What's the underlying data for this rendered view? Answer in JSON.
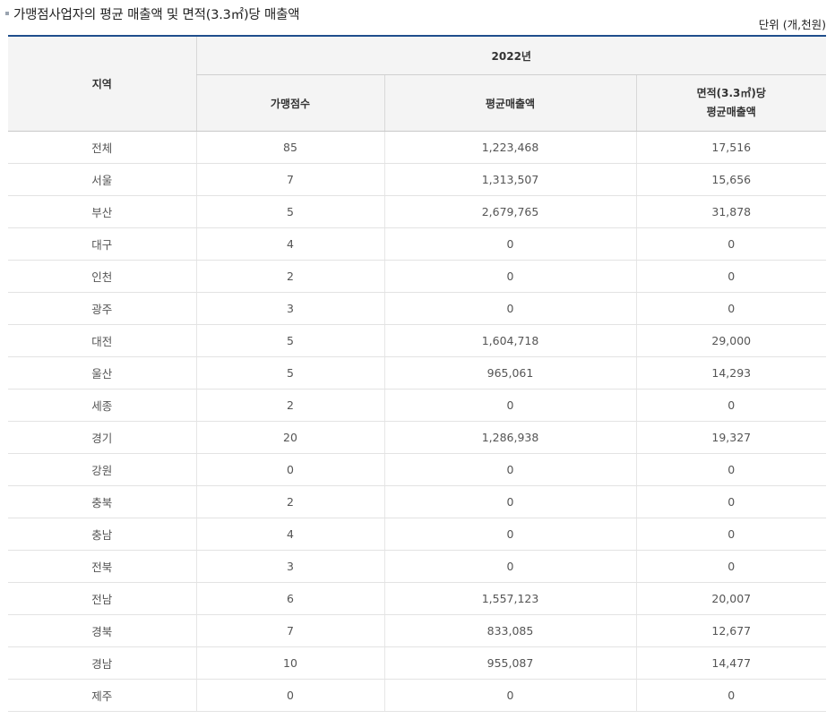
{
  "page": {
    "title": "가맹점사업자의 평균 매출액 및 면적(3.3㎡)당 매출액",
    "unit": "단위 (개,천원)"
  },
  "table": {
    "header": {
      "region": "지역",
      "year": "2022년",
      "stores": "가맹점수",
      "avg_sales": "평균매출액",
      "per_area_line1": "면적(3.3㎡)당",
      "per_area_line2": "평균매출액"
    },
    "rows": [
      {
        "region": "전체",
        "stores": "85",
        "avg_sales": "1,223,468",
        "per_area": "17,516"
      },
      {
        "region": "서울",
        "stores": "7",
        "avg_sales": "1,313,507",
        "per_area": "15,656"
      },
      {
        "region": "부산",
        "stores": "5",
        "avg_sales": "2,679,765",
        "per_area": "31,878"
      },
      {
        "region": "대구",
        "stores": "4",
        "avg_sales": "0",
        "per_area": "0"
      },
      {
        "region": "인천",
        "stores": "2",
        "avg_sales": "0",
        "per_area": "0"
      },
      {
        "region": "광주",
        "stores": "3",
        "avg_sales": "0",
        "per_area": "0"
      },
      {
        "region": "대전",
        "stores": "5",
        "avg_sales": "1,604,718",
        "per_area": "29,000"
      },
      {
        "region": "울산",
        "stores": "5",
        "avg_sales": "965,061",
        "per_area": "14,293"
      },
      {
        "region": "세종",
        "stores": "2",
        "avg_sales": "0",
        "per_area": "0"
      },
      {
        "region": "경기",
        "stores": "20",
        "avg_sales": "1,286,938",
        "per_area": "19,327"
      },
      {
        "region": "강원",
        "stores": "0",
        "avg_sales": "0",
        "per_area": "0"
      },
      {
        "region": "충북",
        "stores": "2",
        "avg_sales": "0",
        "per_area": "0"
      },
      {
        "region": "충남",
        "stores": "4",
        "avg_sales": "0",
        "per_area": "0"
      },
      {
        "region": "전북",
        "stores": "3",
        "avg_sales": "0",
        "per_area": "0"
      },
      {
        "region": "전남",
        "stores": "6",
        "avg_sales": "1,557,123",
        "per_area": "20,007"
      },
      {
        "region": "경북",
        "stores": "7",
        "avg_sales": "833,085",
        "per_area": "12,677"
      },
      {
        "region": "경남",
        "stores": "10",
        "avg_sales": "955,087",
        "per_area": "14,477"
      },
      {
        "region": "제주",
        "stores": "0",
        "avg_sales": "0",
        "per_area": "0"
      }
    ]
  }
}
